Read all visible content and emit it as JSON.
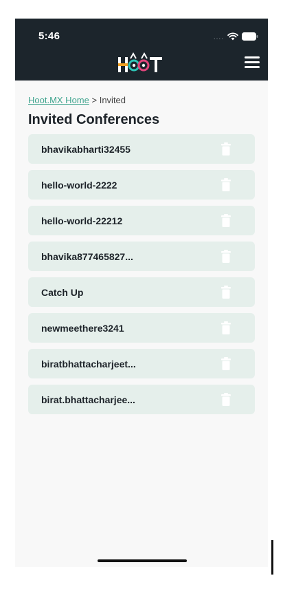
{
  "status_bar": {
    "time": "5:46",
    "signal_dots": "....",
    "icons": [
      "wifi-icon",
      "battery-icon"
    ]
  },
  "header": {
    "logo_text": "HOOT",
    "logo_icon": "hoot-owl-logo",
    "menu_icon": "hamburger-menu-icon"
  },
  "breadcrumb": {
    "home_link": "Hoot.MX Home",
    "separator": ">",
    "current": "Invited"
  },
  "page": {
    "title": "Invited Conferences"
  },
  "conferences": [
    {
      "name": "bhavikabharti32455"
    },
    {
      "name": "hello-world-2222"
    },
    {
      "name": "hello-world-22212"
    },
    {
      "name": "bhavika877465827..."
    },
    {
      "name": "Catch Up"
    },
    {
      "name": "newmeethere3241"
    },
    {
      "name": "biratbhattacharjeet..."
    },
    {
      "name": "birat.bhattacharjee..."
    }
  ],
  "colors": {
    "header_bg": "#1c252c",
    "item_bg": "#e5efeb",
    "link": "#3fa48e",
    "logo_orange": "#f0a020",
    "logo_teal": "#2ec4b6",
    "logo_pink": "#e0457b"
  }
}
